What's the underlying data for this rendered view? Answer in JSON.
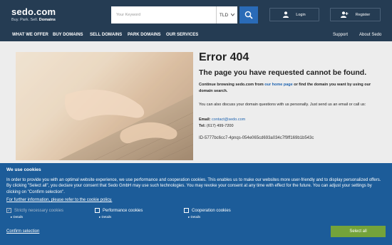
{
  "header": {
    "logo": "sedo.com",
    "logo_tagline": [
      "Buy.",
      "Park.",
      "Sell.",
      "Domains"
    ],
    "search": {
      "placeholder": "Your Keyword",
      "tld_label": "TLD"
    },
    "login_label": "Login",
    "register_label": "Register"
  },
  "nav": {
    "left": [
      "WHAT WE OFFER",
      "BUY DOMAINS",
      "SELL DOMAINS",
      "PARK DOMAINS",
      "OUR SERVICES"
    ],
    "right": [
      "Support",
      "About Sedo"
    ]
  },
  "error": {
    "title": "Error 404",
    "subtitle": "The page you have requested cannot be found.",
    "p1_before": "Continue browsing sedo.com from ",
    "p1_link": "our home page",
    "p1_after": " or find the domain you want by using our domain search.",
    "p2": "You can also discuss your domain questions with us personally. Just send us an email or call us:",
    "email_label": "Email:",
    "email": "contact@sedo.com",
    "tel_label": "Tel:",
    "tel": "(617) 499-7200",
    "id": "ID-5777bc6cc7-4pnqs-054e065cd693a034c7f9ff169b1b543c"
  },
  "cookie": {
    "title": "We use cookies",
    "text": "In order to provide you with an optimal website experience, we use performance and cooperation cookies. This enables us to make our websites more user-friendly and to display personalized offers. By clicking \"Select all\", you declare your consent that Sedo GmbH may use such technologies. You may revoke your consent at any time with effect for the future. You can adjust your settings by clicking on \"Confirm selection\".",
    "policy_link": "For further information, please refer to the cookie policy.",
    "options": [
      {
        "label": "Strictly necessary cookies",
        "details": "Details",
        "checked": true,
        "disabled": true
      },
      {
        "label": "Performance cookies",
        "details": "Details",
        "checked": false,
        "disabled": false
      },
      {
        "label": "Cooperation cookies",
        "details": "Details",
        "checked": false,
        "disabled": false
      }
    ],
    "confirm_label": "Confirm selection",
    "select_all_label": "Select all"
  },
  "colors": {
    "header": "#253c53",
    "cookie_banner": "#1c5c99",
    "accent": "#2a6bb7",
    "select_all": "#74a33a",
    "link": "#1f64b0"
  }
}
